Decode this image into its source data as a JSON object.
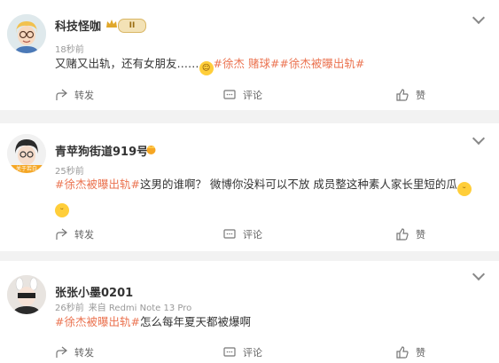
{
  "posts": [
    {
      "username": "科技怪咖",
      "vip_level": "II",
      "time": "18秒前",
      "source": "",
      "content": {
        "text_before": "又赌又出轨，还有女朋友……",
        "tags": [
          "#徐杰 赌球##徐杰被曝出轨#"
        ],
        "text_after": ""
      },
      "actions": {
        "forward": "转发",
        "comment": "评论",
        "like": "赞"
      }
    },
    {
      "username": "青苹狗街道919号",
      "time": "25秒前",
      "source": "",
      "avatar_caption": "关于若白",
      "content": {
        "tag": "#徐杰被曝出轨#",
        "text": "这男的谁啊？ 微博你没料可以不放 成员整这种素人家长里短的瓜"
      },
      "actions": {
        "forward": "转发",
        "comment": "评论",
        "like": "赞"
      }
    },
    {
      "username": "张张小墨0201",
      "time": "26秒前",
      "source": "来自 Redmi Note 13 Pro",
      "content": {
        "tag": "#徐杰被曝出轨#",
        "text": "怎么每年夏天都被爆啊"
      },
      "actions": {
        "forward": "转发",
        "comment": "评论",
        "like": "赞"
      }
    }
  ],
  "colors": {
    "tag": "#eb7350",
    "meta": "#999999",
    "background": "#f2f2f2"
  },
  "icons": [
    "chevron-down-icon",
    "forward-icon",
    "comment-icon",
    "like-icon",
    "vip-badge-icon",
    "crown-icon",
    "laugh-emoji-icon",
    "smirk-emoji-icon"
  ]
}
